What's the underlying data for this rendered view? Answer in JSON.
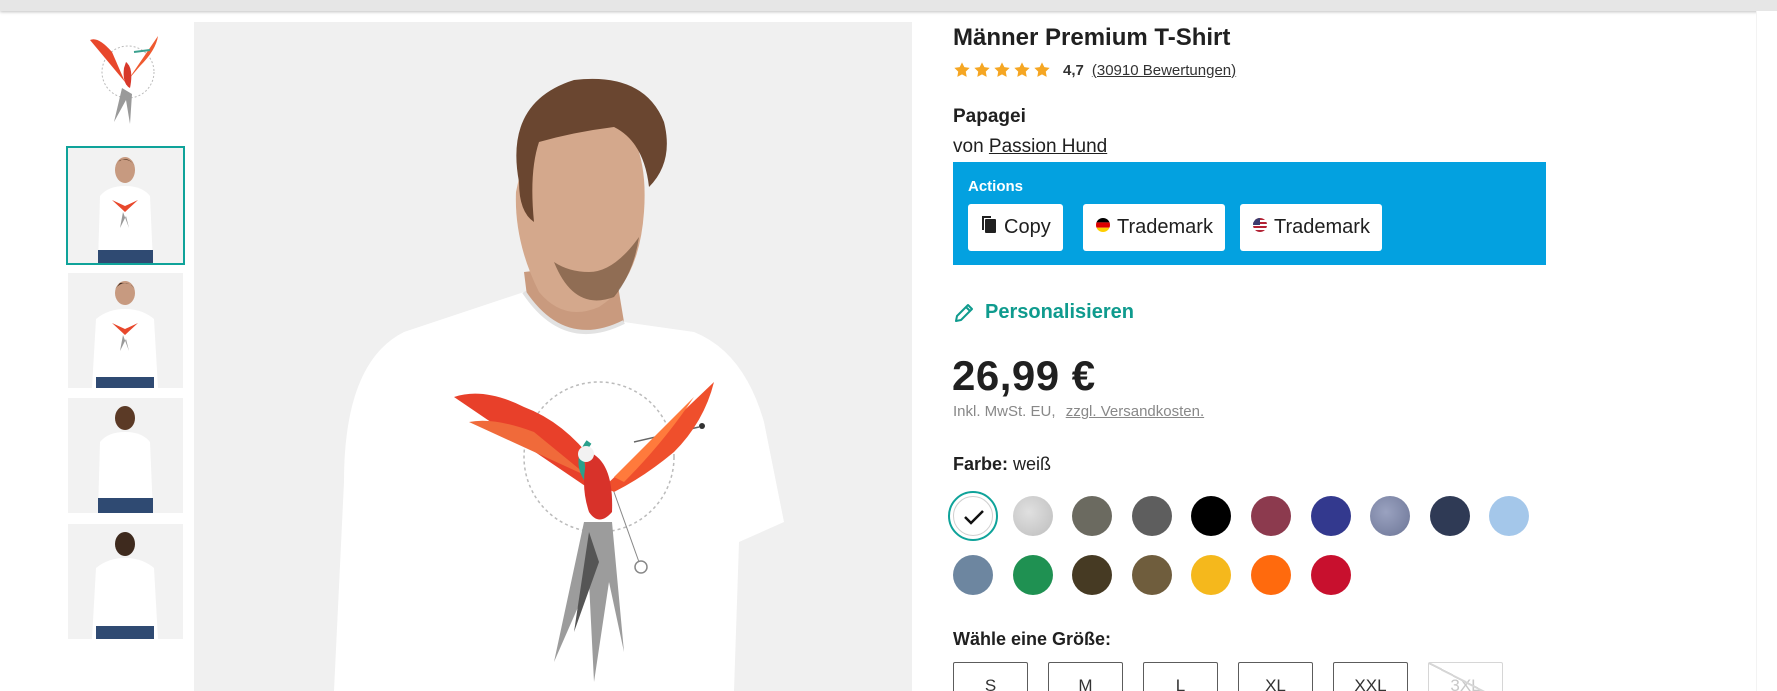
{
  "product": {
    "title": "Männer Premium T-Shirt",
    "rating_value": "4,7",
    "rating_count": "(30910 Bewertungen)",
    "star_count": 5,
    "design_name": "Papagei",
    "designer_prefix": "von",
    "designer_name": "Passion Hund"
  },
  "actions": {
    "title": "Actions",
    "copy_label": "Copy",
    "trademark_de_label": "Trademark",
    "trademark_us_label": "Trademark"
  },
  "personalize_label": "Personalisieren",
  "price": {
    "value": "26,99 €",
    "tax_note": "Inkl. MwSt. EU,",
    "shipping_link": "zzgl. Versandkosten."
  },
  "color": {
    "label": "Farbe:",
    "selected": "weiß",
    "swatches": [
      "#ffffff",
      "#cfcfcf",
      "#6b6a60",
      "#5e5e5e",
      "#000000",
      "#8c3a4e",
      "#33398e",
      "#7d86a8",
      "#2f3a55",
      "#a4c7ea",
      "#6d86a0",
      "#1f9152",
      "#463a23",
      "#6f5d3d",
      "#f5b81c",
      "#ff6a0d",
      "#c8102e"
    ]
  },
  "size": {
    "label": "Wähle eine Größe:",
    "options": [
      "S",
      "M",
      "L",
      "XL",
      "XXL",
      "3XL"
    ],
    "disabled_option": "3XL"
  },
  "colors": {
    "accent": "#0fa39a",
    "actions_bg": "#03a1e0",
    "star": "#f5a623"
  }
}
